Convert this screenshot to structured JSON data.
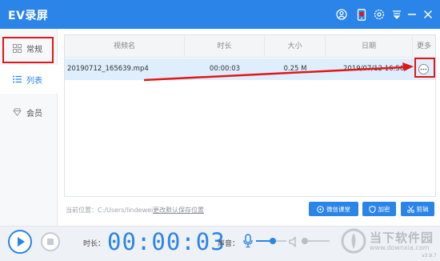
{
  "app": {
    "title": "EV录屏",
    "version": "v3.9.7"
  },
  "titlebar": {
    "icons": [
      "user-icon",
      "phone-icon",
      "settings-icon",
      "dropdown-icon",
      "minimize-icon",
      "close-icon"
    ]
  },
  "sidebar": {
    "items": [
      {
        "label": "常规",
        "icon": "grid-icon",
        "active": false
      },
      {
        "label": "列表",
        "icon": "list-icon",
        "active": true
      },
      {
        "label": "会员",
        "icon": "diamond-icon",
        "active": false
      }
    ]
  },
  "table": {
    "columns": [
      "视频名",
      "时长",
      "大小",
      "日期",
      "更多"
    ],
    "rows": [
      {
        "name": "20190712_165639.mp4",
        "duration": "00:00:03",
        "size": "0.25 M",
        "date": "2019/07/12 16:56"
      }
    ]
  },
  "save_path": {
    "label": "当前位置：C:/Users/lindewei",
    "change_link": "更改默认保存位置"
  },
  "actions": [
    {
      "label": "微信课堂",
      "icon": "chat-icon"
    },
    {
      "label": "加密",
      "icon": "shield-icon"
    },
    {
      "label": "剪辑",
      "icon": "scissors-icon"
    }
  ],
  "bottom": {
    "duration_label": "时长：",
    "timer": "00:00:03",
    "volume_label": "声音：",
    "mic_level": 0.55,
    "speaker_level": 0.1
  },
  "watermark": {
    "text": "当下软件园",
    "url": "www.downxia.com"
  },
  "colors": {
    "accent": "#2b84e8",
    "highlight": "#e0171a"
  }
}
